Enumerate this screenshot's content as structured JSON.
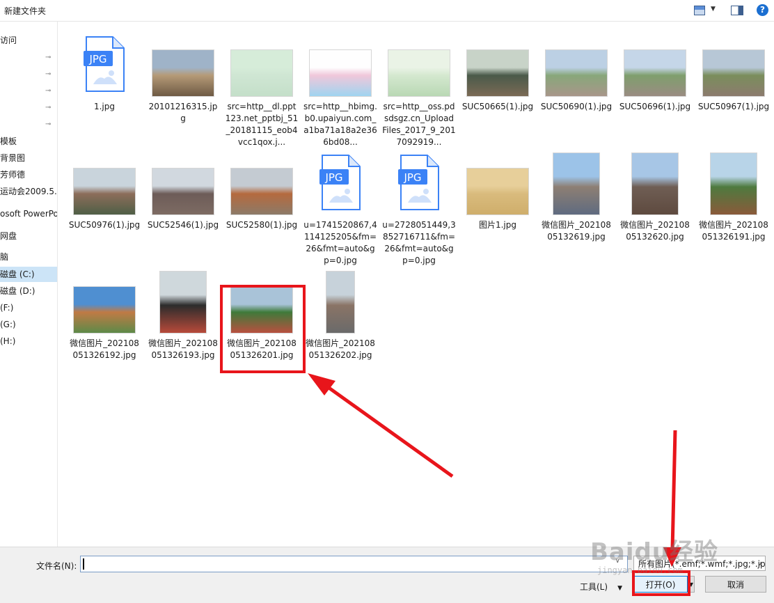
{
  "toolbar": {
    "new_folder": "新建文件夹",
    "help": "?"
  },
  "sidebar": {
    "items": [
      {
        "label": "访问",
        "pinned": false
      },
      {
        "label": "",
        "pinned": true
      },
      {
        "label": "",
        "pinned": true
      },
      {
        "label": "",
        "pinned": true
      },
      {
        "label": "",
        "pinned": true
      },
      {
        "label": "",
        "pinned": true
      },
      {
        "label": "模板",
        "pinned": false
      },
      {
        "label": "背景图",
        "pinned": false
      },
      {
        "label": "芳师德",
        "pinned": false
      },
      {
        "label": "运动会2009.5.",
        "pinned": false
      },
      {
        "label": "osoft PowerPo",
        "pinned": false
      },
      {
        "label": "网盘",
        "pinned": false
      },
      {
        "label": "脑",
        "pinned": false
      },
      {
        "label": "磁盘 (C:)",
        "pinned": false,
        "selected": true
      },
      {
        "label": "磁盘 (D:)",
        "pinned": false
      },
      {
        "label": " (F:)",
        "pinned": false
      },
      {
        "label": " (G:)",
        "pinned": false
      },
      {
        "label": " (H:)",
        "pinned": false
      }
    ],
    "pin_glyph": "📌"
  },
  "files": [
    {
      "name": "1.jpg",
      "kind": "jpg-icon"
    },
    {
      "name": "20101216315.jpg",
      "kind": "photo",
      "colors": [
        "#9fb3c8",
        "#b59a77",
        "#6e5a44"
      ]
    },
    {
      "name": "src=http__dl.ppt123.net_pptbj_51_20181115_eob4vcc1qox.j...",
      "kind": "photo",
      "colors": [
        "#d6ecd9",
        "#cfe6d3",
        "#c4dfc9"
      ]
    },
    {
      "name": "src=http__hbimg.b0.upaiyun.com_a1ba71a18a2e366bd08...",
      "kind": "photo",
      "colors": [
        "#fefefe",
        "#f0c7da",
        "#9fd4f0"
      ]
    },
    {
      "name": "src=http__oss.pdsdsgz.cn_UploadFiles_2017_9_2017092919...",
      "kind": "photo",
      "colors": [
        "#eaf3e6",
        "#d4e8cf",
        "#b9d8b4"
      ]
    },
    {
      "name": "SUC50665(1).jpg",
      "kind": "photo",
      "colors": [
        "#c8d3c8",
        "#4a5a4a",
        "#7b6a55"
      ]
    },
    {
      "name": "SUC50690(1).jpg",
      "kind": "photo",
      "colors": [
        "#bcd0e4",
        "#88a77a",
        "#a8968a"
      ]
    },
    {
      "name": "SUC50696(1).jpg",
      "kind": "photo",
      "colors": [
        "#c5d6e8",
        "#7f9f6d",
        "#9a8c82"
      ]
    },
    {
      "name": "SUC50967(1).jpg",
      "kind": "photo",
      "colors": [
        "#b7c7d6",
        "#7a8e5c",
        "#8c7b6e"
      ]
    },
    {
      "name": "SUC50976(1).jpg",
      "kind": "photo",
      "colors": [
        "#c9d4dc",
        "#8c6d5a",
        "#4f5f46"
      ]
    },
    {
      "name": "SUC52546(1).jpg",
      "kind": "photo",
      "colors": [
        "#d1d8df",
        "#6d5c58",
        "#7d6b63"
      ]
    },
    {
      "name": "SUC52580(1).jpg",
      "kind": "photo",
      "colors": [
        "#c4cbd2",
        "#b56a3e",
        "#8c7a68"
      ]
    },
    {
      "name": "u=1741520867,4114125205&fm=26&fmt=auto&gp=0.jpg",
      "kind": "jpg-icon"
    },
    {
      "name": "u=2728051449,3852716711&fm=26&fmt=auto&gp=0.jpg",
      "kind": "jpg-icon"
    },
    {
      "name": "图片1.jpg",
      "kind": "photo",
      "colors": [
        "#e7cf9a",
        "#d9bb7d",
        "#cfae6b"
      ]
    },
    {
      "name": "微信图片_20210805132619.jpg",
      "kind": "photo-tall",
      "colors": [
        "#9cc3e8",
        "#8d7f73",
        "#5f6b80"
      ]
    },
    {
      "name": "微信图片_20210805132620.jpg",
      "kind": "photo-tall",
      "colors": [
        "#a7c6e6",
        "#6f5e54",
        "#5e4a3f"
      ]
    },
    {
      "name": "微信图片_202108051326191.jpg",
      "kind": "photo-tall",
      "colors": [
        "#b8d4e8",
        "#4e7a3f",
        "#8a5a3a"
      ]
    },
    {
      "name": "微信图片_202108051326192.jpg",
      "kind": "photo",
      "colors": [
        "#4f8fd1",
        "#c07a45",
        "#5d8a48"
      ]
    },
    {
      "name": "微信图片_202108051326193.jpg",
      "kind": "photo-tall",
      "colors": [
        "#cfd8dc",
        "#2c2c2c",
        "#b84a3a"
      ]
    },
    {
      "name": "微信图片_202108051326201.jpg",
      "kind": "photo",
      "colors": [
        "#a9c3d8",
        "#3f7a3a",
        "#b8503f"
      ],
      "highlighted": true
    },
    {
      "name": "微信图片_202108051326202.jpg",
      "kind": "photo-tall",
      "colors": [
        "#c7d2da",
        "#8a7466",
        "#6a6a6a"
      ]
    }
  ],
  "bottom": {
    "filename_label": "文件名(N):",
    "filename_value": "",
    "filter": "所有图片(*.emf;*.wmf;*.jpg;*.jp",
    "tools": "工具(L)",
    "open": "打开(O)",
    "cancel": "取消"
  },
  "overlay": {
    "annotation_color": "#e8151b",
    "watermark": "Baidu经验",
    "watermark_sub": "jingyan.baidu.com"
  }
}
